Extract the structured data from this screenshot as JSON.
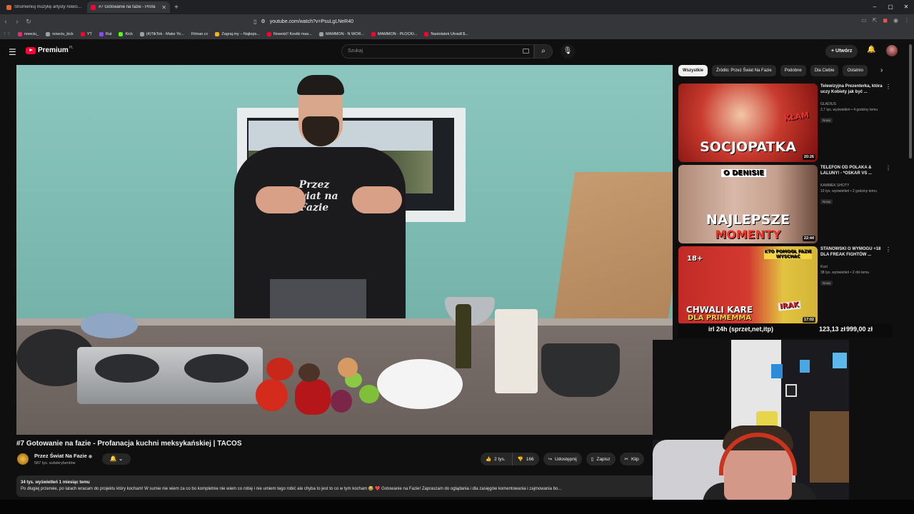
{
  "browser": {
    "tabs": [
      {
        "label": "Strumieniuj muzykę artysty nowciu |",
        "active": false
      },
      {
        "label": "#7 Gotowanie na fazie - Profa",
        "active": true
      }
    ],
    "new_tab": "+",
    "url": "youtube.com/watch?v=PsuLgLNeR40",
    "bookmarks": [
      "nowciu_",
      "nowciu_kick",
      "YT",
      "Rat",
      "Kick",
      "(4)TikTok - Make Yo...",
      "Filman.cc",
      "Zagraj.my – Najleps...",
      "Nowość! Kostki mas...",
      "MAMMON - N WOR...",
      "MAMMON - PŁOCKI...",
      "Nastolatek Ukradł $..."
    ]
  },
  "masthead": {
    "logo": "Premium",
    "region": "PL",
    "search_placeholder": "Szukaj",
    "create_label": "Utwórz"
  },
  "video": {
    "title": "#7 Gotowanie na fazie - Profanacja kuchni meksykańskiej | TACOS",
    "shirt_text": "Przez Świat na Fazie",
    "channel": "Przez Świat Na Fazie",
    "subscribers": "587 tys. subskrybentów",
    "likes": "2 tys.",
    "dislikes": "166",
    "share": "Udostępnij",
    "save": "Zapisz",
    "clip": "Klip",
    "meta": "34 tys. wyświetleń  1 miesiąc temu",
    "description": "Po długiej przerwie, po latach wracam do projektu który kocham! W sumie nie wiem za co bo kompletnie nie wiem co robię i nie umiem tego robić ale chyba to jest to co w tym kocham 😂 ❤️ Gotowanie na Fazie! Zapraszam do oglądania i dla zasięgów komentowania i zajmowania bo..."
  },
  "sidebar": {
    "chips": [
      "Wszystkie",
      "Źródło: Przez Świat Na Fazie",
      "Podobne",
      "Dla Ciebie",
      "Ostatnio"
    ],
    "recommendations": [
      {
        "title": "Telewizyjna Prezenterka, która uczy Kobiety jak być ...",
        "channel": "GLADIUS",
        "views": "2,7 tys. wyświetleń • 4 godziny temu",
        "badge": "Nowy",
        "duration": "20:26",
        "thumb_text": "SOCJOPATKA",
        "thumb_text2": "KŁAM"
      },
      {
        "title": "TELEFON OD POLAKA & LALUNY! - *OSKAR VS ...",
        "channel": "KAMMEK SHOTY",
        "views": "10 tys. wyświetleń • 2 godziny temu",
        "badge": "Nowy",
        "duration": "22:44",
        "thumb_text": "NAJLEPSZE",
        "thumb_text2": "MOMENTY",
        "thumb_text3": "O DENISIE"
      },
      {
        "title": "STANOWSKI O WYMOGU +18 DLA FREAK FIGHTÓW ...",
        "channel": "Kozi",
        "views": "38 tys. wyświetleń • 2 dni temu",
        "badge": "Nowy",
        "duration": "17:02",
        "thumb_text": "CHWALI KARE",
        "thumb_text2": "DLA PRIMEMMA",
        "thumb_text3": "KTO POMOGŁ FAZIE WYSCHAĆ",
        "thumb_text4": "18+",
        "thumb_text5": "IRAK"
      }
    ]
  },
  "ticker": {
    "item1": "irl 24h (sprzet,net,itp)",
    "item2": "123,13 zł",
    "item3": "999,00 zł"
  }
}
